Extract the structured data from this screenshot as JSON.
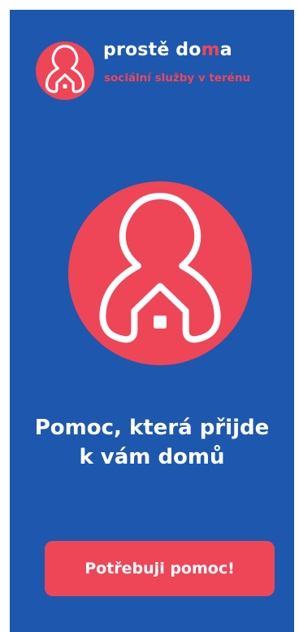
{
  "brand": {
    "name_part1": "prostě do",
    "name_highlight": "m",
    "name_part2": "a",
    "tagline": "sociální služby v terénu",
    "logo_icon": "person-house-icon"
  },
  "hero": {
    "icon": "person-house-icon"
  },
  "headline": {
    "line1": "Pomoc, která přijde",
    "line2": "k vám domů"
  },
  "cta": {
    "label": "Potřebuji pomoc!"
  },
  "colors": {
    "background": "#1E57AE",
    "accent": "#EE4657",
    "text": "#FFFFFF"
  }
}
